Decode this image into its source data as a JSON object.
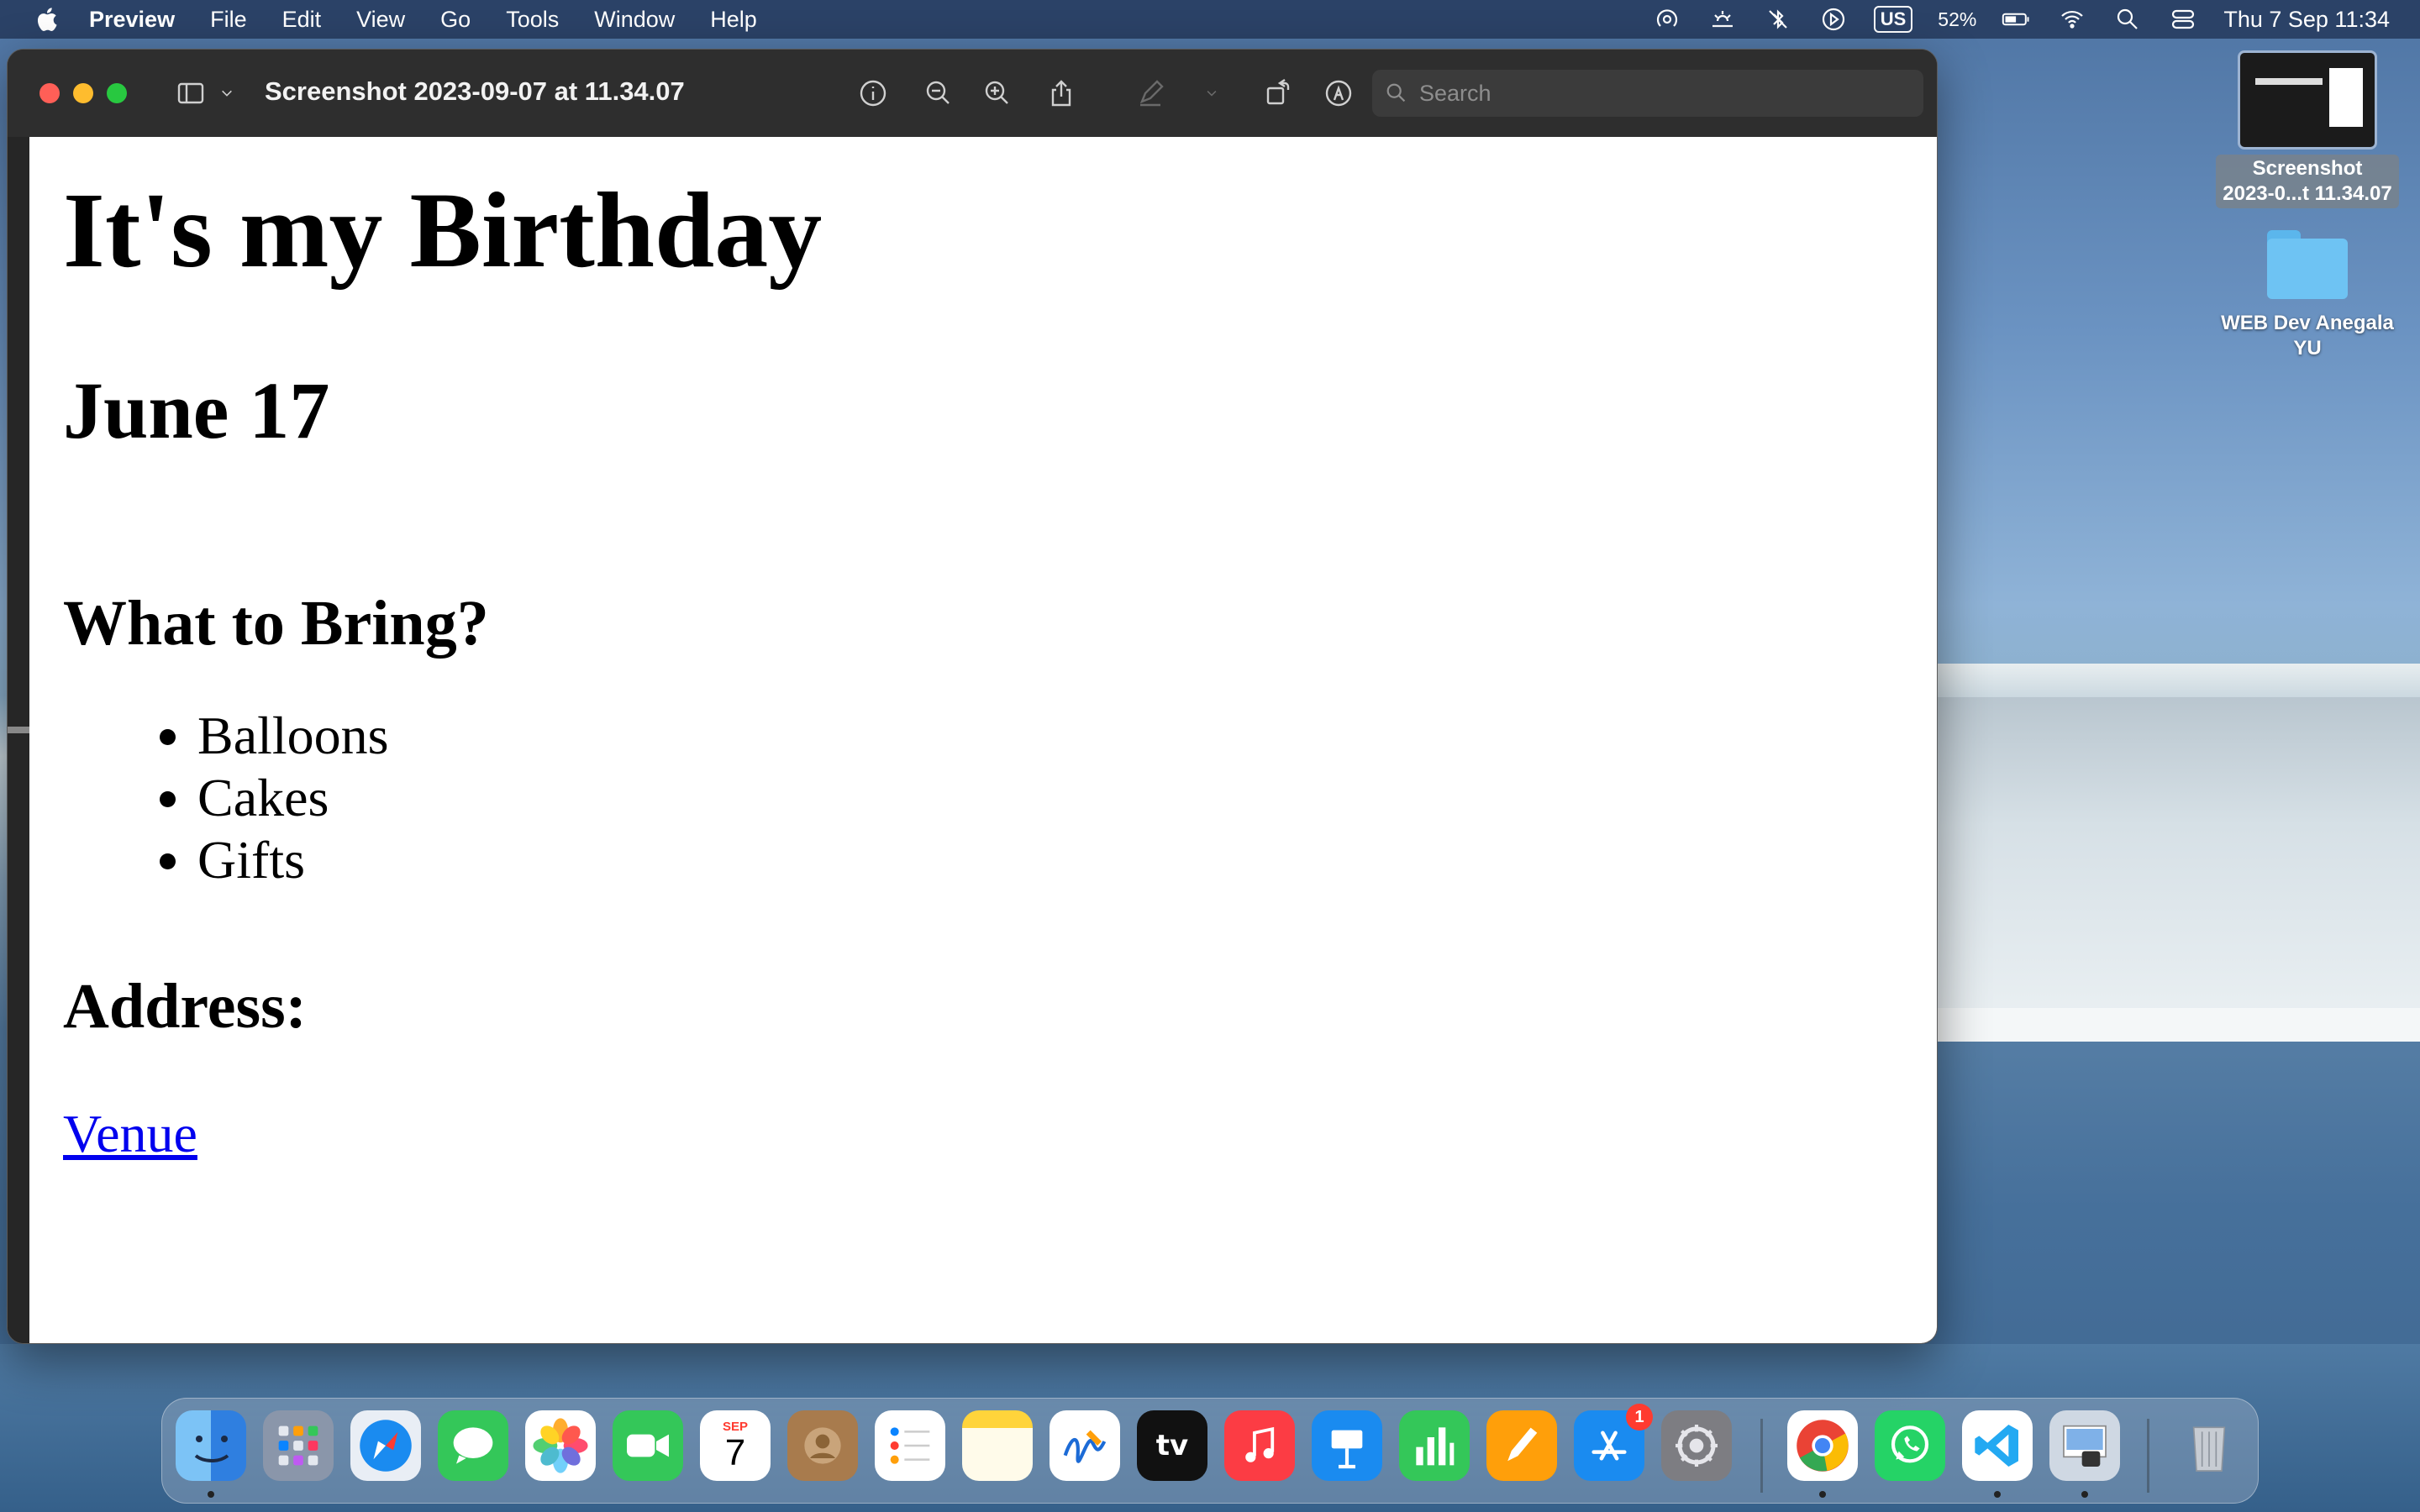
{
  "menubar": {
    "app_name": "Preview",
    "menus": [
      "File",
      "Edit",
      "View",
      "Go",
      "Tools",
      "Window",
      "Help"
    ],
    "input_source": "US",
    "battery_percent": "52%",
    "datetime": "Thu 7 Sep  11:34"
  },
  "window": {
    "title": "Screenshot 2023-09-07 at 11.34.07",
    "search_placeholder": "Search"
  },
  "document": {
    "heading": "It's my Birthday",
    "date": "June 17",
    "bring_heading": "What to Bring?",
    "bring_items": [
      "Balloons",
      "Cakes",
      "Gifts"
    ],
    "address_heading": "Address:",
    "venue_link": "Venue"
  },
  "desktop": {
    "screenshot_label_1": "Screenshot",
    "screenshot_label_2": "2023-0...t 11.34.07",
    "folder_label_1": "WEB Dev Anegala",
    "folder_label_2": "YU"
  },
  "dock": {
    "calendar_month": "SEP",
    "calendar_day": "7",
    "appstore_badge": "1",
    "tv_label": "tv"
  }
}
